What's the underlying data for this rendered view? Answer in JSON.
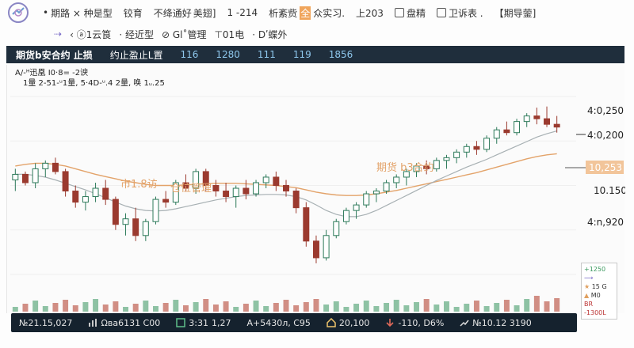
{
  "topbar": {
    "items": [
      {
        "label": "期路 × 种是型",
        "icon": "bullet"
      },
      {
        "label": "铰育",
        "icon": ""
      },
      {
        "label": "不绛通好",
        "icon": ""
      },
      {
        "label": "美翅]",
        "icon": ""
      },
      {
        "label": "1 -214",
        "icon": ""
      },
      {
        "label": "析紊赀",
        "icon": ""
      },
      {
        "label": "全",
        "icon": "highlight"
      },
      {
        "label": "众实习.",
        "icon": ""
      },
      {
        "label": "上203",
        "icon": ""
      },
      {
        "label": "盘精",
        "icon": "square"
      },
      {
        "label": "卫诉表 .",
        "icon": "square"
      },
      {
        "label": "【期导蓥]",
        "icon": ""
      }
    ]
  },
  "navbar": {
    "arrow": "⇢",
    "items": [
      "‹ ⓐ1云筤",
      "· 经近型",
      "⊘ Gl˚管理",
      "⊤01电",
      "· Dʹ蝶外"
    ]
  },
  "titlebar": {
    "name": "期货b安合约 止损",
    "label": "约止盈止L置",
    "values": [
      "116",
      "1280",
      "111",
      "119",
      "1856"
    ]
  },
  "legend": {
    "line1": "A/-ᴴ迅凰   I0·8= -2谀",
    "line2": "1量 2-51-ᵘ1量, 5·4D-ᵘ.4 2量, 唤 1ᵤ.25"
  },
  "annotations": {
    "price_label": "市1.8访",
    "position_label": "仓位管理",
    "contract_label": "期货 b3合约"
  },
  "price_axis": {
    "labels": [
      "4:0,250",
      "4:0,200",
      "10,253",
      "10.150",
      "4:n,920"
    ],
    "current": "10,253"
  },
  "statusbar": {
    "items": [
      {
        "icon": "",
        "text": "№21.15,027"
      },
      {
        "icon": "chart-icon",
        "text": "Ωвa6131 C00"
      },
      {
        "icon": "box-icon",
        "text": "3:31",
        "extra": "1,27"
      },
      {
        "icon": "",
        "text": "A+5430л, C95"
      },
      {
        "icon": "home-icon",
        "text": "20,100"
      },
      {
        "icon": "down-icon",
        "text": "-110, D6%"
      },
      {
        "icon": "trend-icon",
        "text": "№10.12 3190"
      }
    ]
  },
  "sidepanel": {
    "line1": "+1250",
    "line2": "15 G",
    "line3": "M0",
    "line4": "BR -1300L"
  },
  "colors": {
    "up": "#2d7a5a",
    "down": "#9b3a2f",
    "ma_orange": "#e0a060",
    "ma_gray": "#9aa3a8",
    "accent": "#f0a55c",
    "dark": "#1f2e3c"
  },
  "chart_data": {
    "type": "candlestick",
    "note_data": "approximate OHLC read from screenshot",
    "candles": [
      [
        10130,
        10150,
        10110,
        10140
      ],
      [
        10140,
        10145,
        10120,
        10125
      ],
      [
        10125,
        10160,
        10115,
        10150
      ],
      [
        10150,
        10165,
        10135,
        10160
      ],
      [
        10160,
        10170,
        10140,
        10145
      ],
      [
        10145,
        10150,
        10100,
        10110
      ],
      [
        10110,
        10120,
        10080,
        10090
      ],
      [
        10090,
        10110,
        10075,
        10100
      ],
      [
        10100,
        10125,
        10090,
        10115
      ],
      [
        10115,
        10130,
        10085,
        10095
      ],
      [
        10095,
        10100,
        10040,
        10050
      ],
      [
        10050,
        10070,
        10030,
        10060
      ],
      [
        10060,
        10080,
        10020,
        10030
      ],
      [
        10030,
        10060,
        10020,
        10055
      ],
      [
        10055,
        10100,
        10050,
        10095
      ],
      [
        10095,
        10110,
        10080,
        10090
      ],
      [
        10090,
        10130,
        10085,
        10125
      ],
      [
        10125,
        10140,
        10110,
        10115
      ],
      [
        10115,
        10150,
        10105,
        10145
      ],
      [
        10145,
        10150,
        10110,
        10120
      ],
      [
        10120,
        10130,
        10100,
        10110
      ],
      [
        10110,
        10125,
        10090,
        10100
      ],
      [
        10100,
        10120,
        10080,
        10115
      ],
      [
        10115,
        10130,
        10095,
        10105
      ],
      [
        10105,
        10130,
        10100,
        10125
      ],
      [
        10125,
        10140,
        10115,
        10135
      ],
      [
        10135,
        10145,
        10110,
        10120
      ],
      [
        10120,
        10130,
        10100,
        10110
      ],
      [
        10110,
        10115,
        10070,
        10080
      ],
      [
        10080,
        10090,
        10010,
        10020
      ],
      [
        10020,
        10030,
        9980,
        9990
      ],
      [
        9990,
        10040,
        9985,
        10030
      ],
      [
        10030,
        10060,
        10025,
        10055
      ],
      [
        10055,
        10080,
        10050,
        10075
      ],
      [
        10075,
        10090,
        10060,
        10085
      ],
      [
        10085,
        10110,
        10080,
        10105
      ],
      [
        10105,
        10115,
        10090,
        10110
      ],
      [
        10110,
        10130,
        10105,
        10125
      ],
      [
        10125,
        10140,
        10115,
        10135
      ],
      [
        10135,
        10150,
        10120,
        10145
      ],
      [
        10145,
        10160,
        10135,
        10155
      ],
      [
        10155,
        10165,
        10140,
        10150
      ],
      [
        10150,
        10170,
        10145,
        10165
      ],
      [
        10165,
        10175,
        10150,
        10170
      ],
      [
        10170,
        10185,
        10160,
        10180
      ],
      [
        10180,
        10195,
        10170,
        10190
      ],
      [
        10190,
        10200,
        10175,
        10185
      ],
      [
        10185,
        10210,
        10180,
        10205
      ],
      [
        10205,
        10225,
        10195,
        10220
      ],
      [
        10220,
        10235,
        10210,
        10215
      ],
      [
        10215,
        10240,
        10210,
        10235
      ],
      [
        10235,
        10250,
        10225,
        10245
      ],
      [
        10245,
        10260,
        10230,
        10240
      ],
      [
        10240,
        10262,
        10225,
        10230
      ],
      [
        10230,
        10245,
        10215,
        10225
      ]
    ],
    "yrange": [
      9960,
      10280
    ],
    "ma_orange": [
      10155,
      10158,
      10160,
      10160,
      10158,
      10155,
      10150,
      10145,
      10140,
      10136,
      10132,
      10128,
      10125,
      10122,
      10120,
      10120,
      10120,
      10121,
      10122,
      10123,
      10124,
      10124,
      10124,
      10123,
      10122,
      10121,
      10120,
      10118,
      10116,
      10112,
      10108,
      10105,
      10103,
      10102,
      10102,
      10103,
      10105,
      10108,
      10111,
      10115,
      10119,
      10123,
      10127,
      10131,
      10135,
      10139,
      10143,
      10148,
      10153,
      10158,
      10163,
      10168,
      10172,
      10175,
      10177
    ],
    "ma_gray": [
      10140,
      10140,
      10138,
      10135,
      10130,
      10124,
      10118,
      10112,
      10105,
      10098,
      10090,
      10083,
      10078,
      10075,
      10074,
      10075,
      10078,
      10082,
      10086,
      10090,
      10094,
      10097,
      10100,
      10102,
      10103,
      10104,
      10104,
      10103,
      10100,
      10094,
      10085,
      10075,
      10068,
      10064,
      10064,
      10068,
      10075,
      10084,
      10093,
      10102,
      10111,
      10120,
      10129,
      10137,
      10145,
      10153,
      10160,
      10167,
      10175,
      10183,
      10191,
      10199,
      10207,
      10213,
      10218
    ]
  }
}
